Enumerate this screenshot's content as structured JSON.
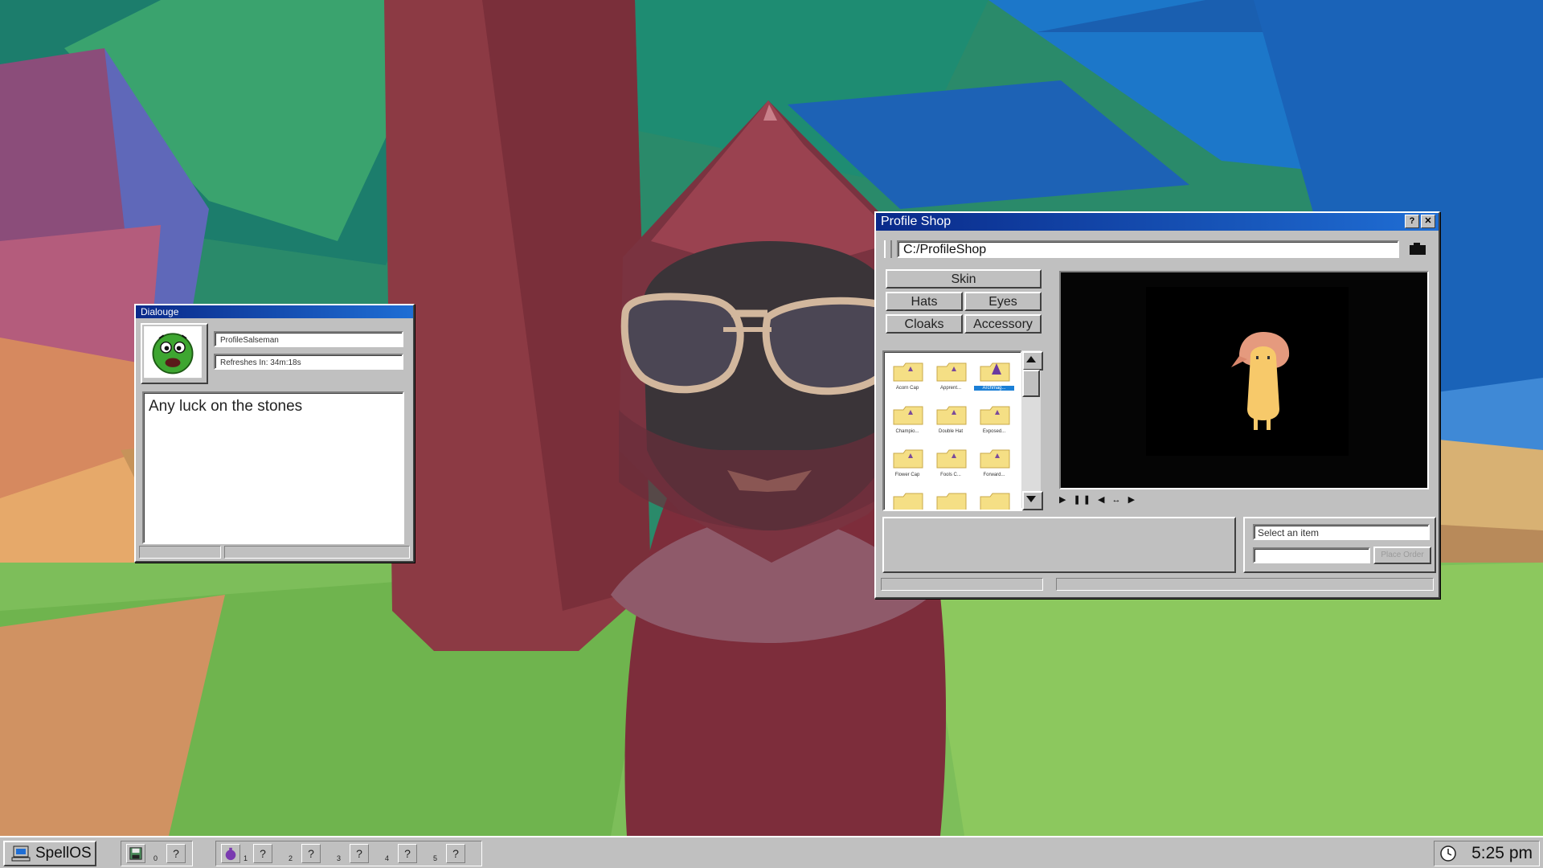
{
  "dialogue": {
    "title": "Dialouge",
    "npc_name": "ProfileSalseman",
    "refresh_text": "Refreshes In: 34m:18s",
    "message": "Any luck on the stones"
  },
  "shop": {
    "title": "Profile Shop",
    "help_label": "?",
    "close_label": "✕",
    "address": "C:/ProfileShop",
    "categories": [
      "Skin",
      "Hats",
      "Eyes",
      "Cloaks",
      "Accessory"
    ],
    "items": [
      "Acorn Cap",
      "Apprent...",
      "Archmag...",
      "Champio...",
      "Double Hat",
      "Exposed...",
      "Flower Cap",
      "Fools C...",
      "Forward..."
    ],
    "selected_item": "Archmag...",
    "media_controls": "▶ ❚❚ ◀ ↔ ▶",
    "order_placeholder": "Select an item",
    "order_button": "Place Order"
  },
  "taskbar": {
    "start_label": "SpellOS",
    "slot_label": "?",
    "slot_numbers": [
      "0",
      "1",
      "2",
      "3",
      "4",
      "5"
    ],
    "clock": "5:25 pm"
  },
  "colors": {
    "title_gradient_start": "#0a2a8a",
    "title_gradient_end": "#1f6ed4",
    "window_face": "#c0c0c0",
    "folder_yellow": "#f5df85",
    "selection_blue": "#1b7fd6"
  },
  "icons": [
    "computer-icon",
    "floppy-disk-icon",
    "potion-icon",
    "folder-icon",
    "clock-icon",
    "help-icon",
    "close-icon",
    "scroll-up-icon",
    "scroll-down-icon",
    "camera-icon"
  ]
}
